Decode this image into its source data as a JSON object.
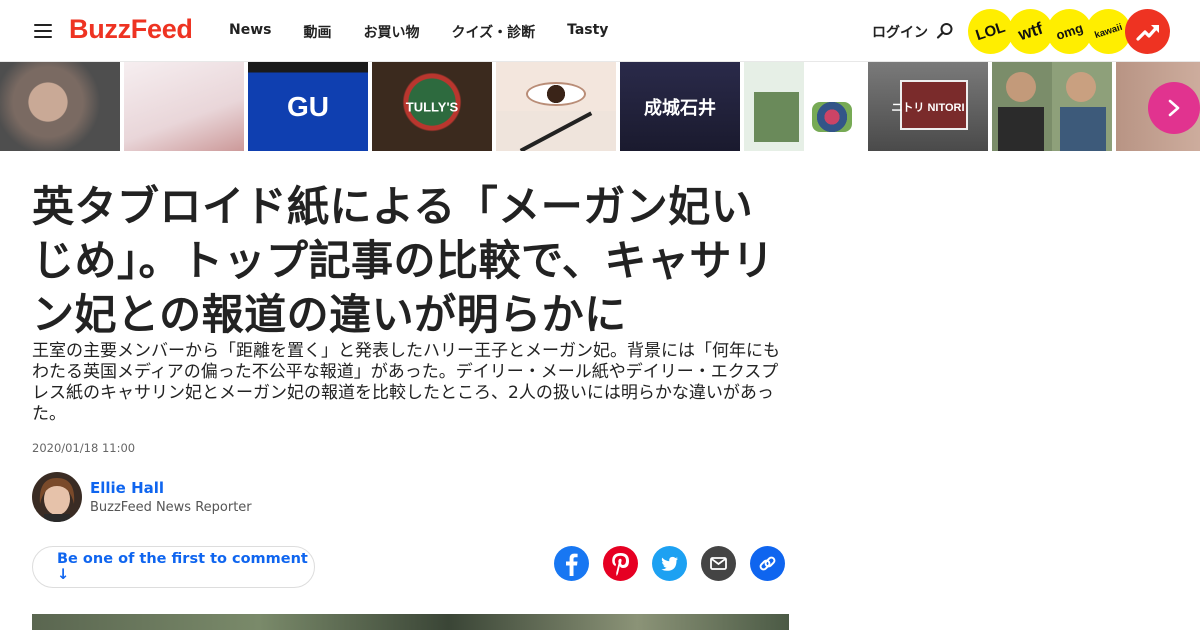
{
  "header": {
    "logo": "BuzzFeed",
    "nav": [
      {
        "label": "News"
      },
      {
        "label": "動画"
      },
      {
        "label": "お買い物"
      },
      {
        "label": "クイズ・診断"
      },
      {
        "label": "Tasty"
      }
    ],
    "login": "ログイン",
    "badges": [
      "LOL",
      "wtf",
      "omg",
      "kawaii"
    ],
    "trending_icon": "trending-icon"
  },
  "strip": {
    "thumbs": [
      {
        "label": "",
        "bg": "#6b6b6b"
      },
      {
        "label": "",
        "bg": "#f1e4e6"
      },
      {
        "label": "GU",
        "bg": "#0f3fb0"
      },
      {
        "label": "TULLY'S",
        "bg": "#2f3e2a"
      },
      {
        "label": "",
        "bg": "#f5ebe4"
      },
      {
        "label": "成城石井",
        "bg": "#1d1d3d"
      },
      {
        "label": "",
        "bg": "#e7efe7"
      },
      {
        "label": "ニトリ NITORI",
        "bg": "#5a5a5a"
      },
      {
        "label": "",
        "bg": "#6a7a5a"
      },
      {
        "label": "",
        "bg": "#c8a89c"
      }
    ]
  },
  "article": {
    "title": "英タブロイド紙による「メーガン妃いじめ」。トップ記事の比較で、キャサリン妃との報道の違いが明らかに",
    "description": "王室の主要メンバーから「距離を置く」と発表したハリー王子とメーガン妃。背景には「何年にもわたる英国メディアの偏った不公平な報道」があった。デイリー・メール紙やデイリー・エクスプレス紙のキャサリン妃とメーガン妃の報道を比較したところ、2人の扱いには明らかな違いがあった。",
    "date": "2020/01/18 11:00",
    "author": {
      "name": "Ellie Hall",
      "role": "BuzzFeed News Reporter"
    },
    "comment_label": "Be one of the first to comment ↓"
  },
  "share": {
    "colors": {
      "facebook": "#1877f2",
      "pinterest": "#e60023",
      "twitter": "#1da1f2",
      "email": "#444444",
      "link": "#0f65ef"
    }
  },
  "colors": {
    "brand": "#ee3322",
    "accent": "#0f65ef",
    "badge": "#ffee00"
  }
}
